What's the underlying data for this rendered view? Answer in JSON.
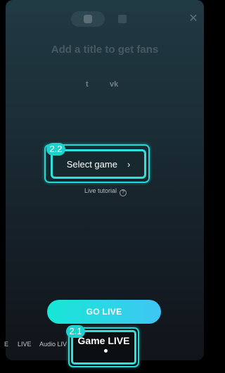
{
  "topbar": {
    "close_glyph": "✕"
  },
  "title": {
    "placeholder": "Add a title to get fans"
  },
  "share": {
    "twitter_glyph": "t",
    "vk_glyph": "vk"
  },
  "select_game": {
    "badge": "2.2",
    "label": "Select game",
    "chevron": "›"
  },
  "tutorial": {
    "label": "Live tutorial",
    "help_glyph": "?"
  },
  "go_live": {
    "label": "GO LIVE"
  },
  "mode_tabs": {
    "badge": "2.1",
    "items": [
      "E",
      "LIVE",
      "Audio LIV",
      "Game LIVE"
    ],
    "active": "Game LIVE"
  },
  "colors": {
    "accent": "#20d9d5",
    "button_gradient_start": "#17e7d6",
    "button_gradient_end": "#3fc6f3"
  }
}
